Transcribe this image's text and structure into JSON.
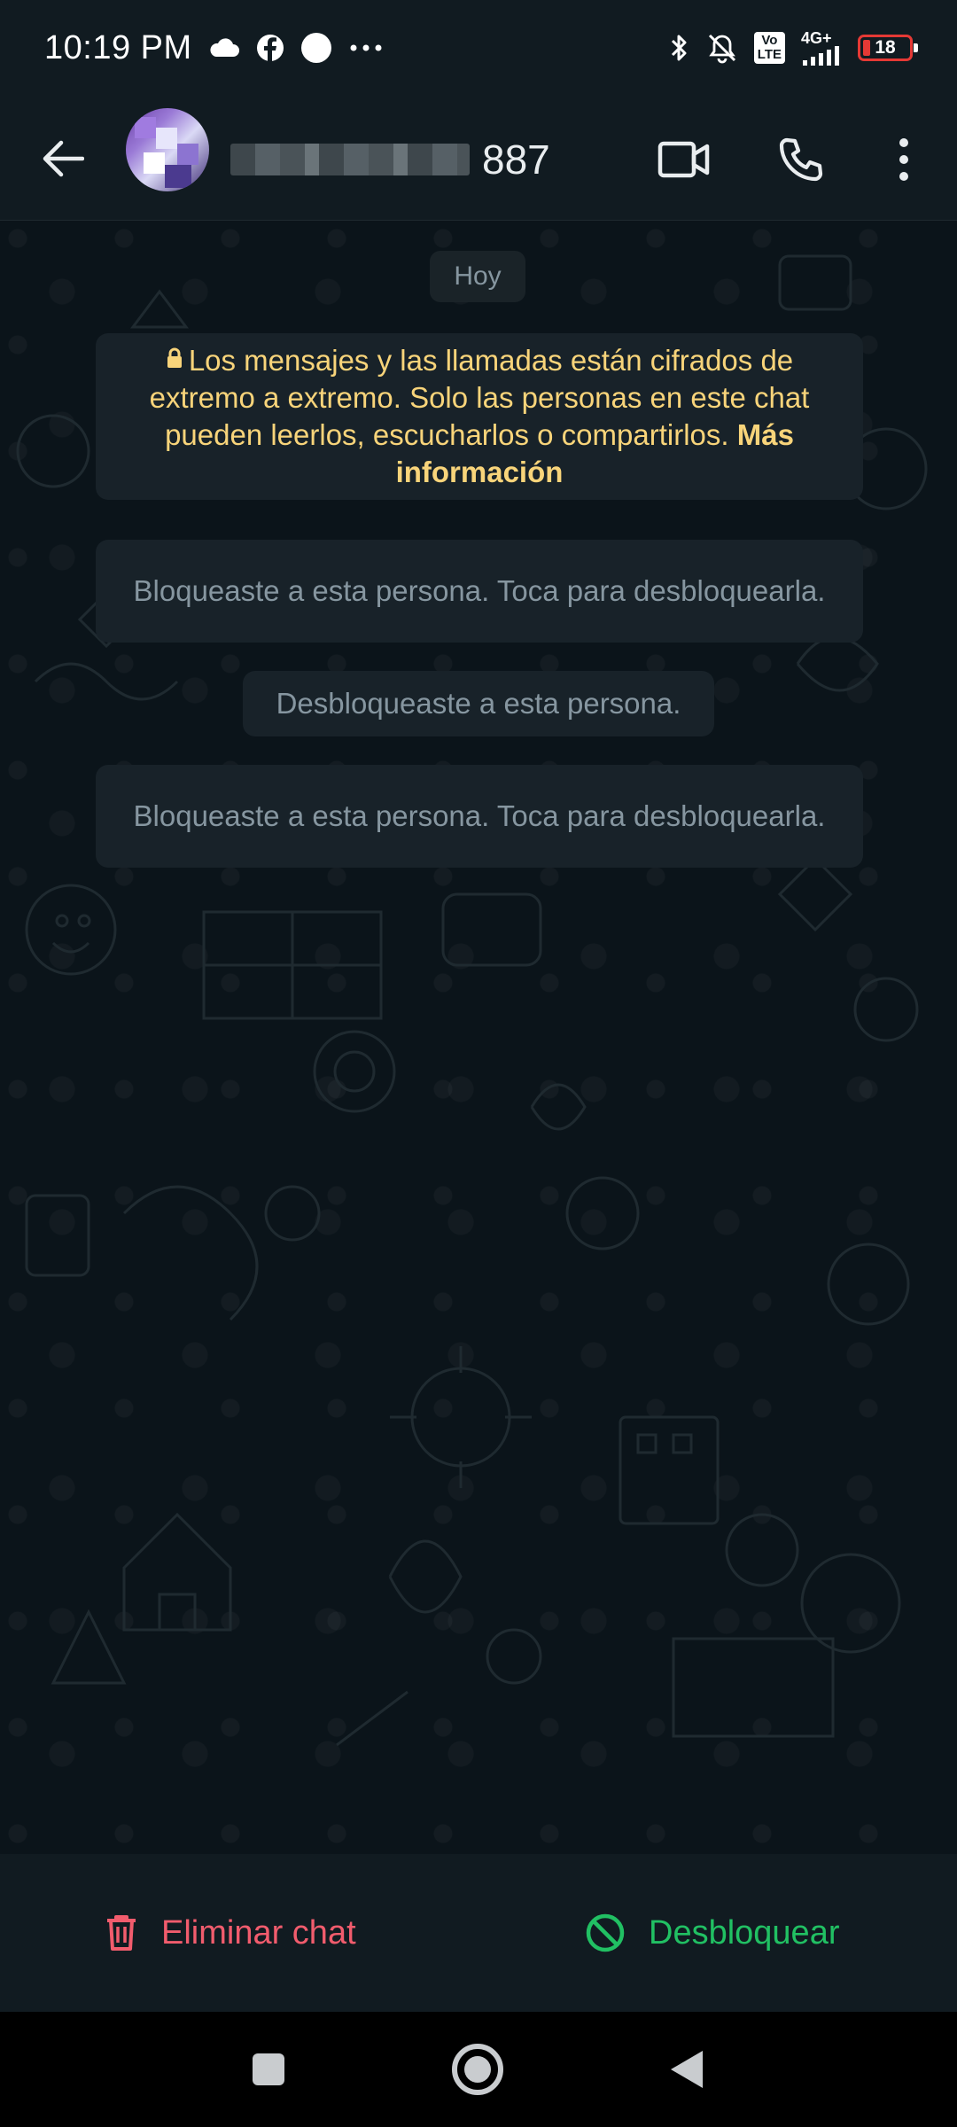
{
  "status_bar": {
    "time": "10:19 PM",
    "left_icons": [
      "cloud-icon",
      "facebook-icon",
      "circle-notification-icon",
      "more-dots-icon"
    ],
    "right_icons": [
      "bluetooth-icon",
      "bell-muted-icon",
      "volte-icon",
      "signal-icon",
      "battery-icon"
    ],
    "volte_label": "Vo\nLTE",
    "network_label": "4G+",
    "battery_level": "18",
    "battery_color": "#e53935"
  },
  "app_bar": {
    "contact_name_visible": "887",
    "actions": [
      "back-arrow-icon",
      "video-call-icon",
      "phone-icon",
      "more-vert-icon"
    ]
  },
  "chat": {
    "date_chip": "Hoy",
    "encryption_notice": {
      "text": "Los mensajes y las llamadas están cifrados de extremo a extremo. Solo las personas en este chat pueden leerlos, escucharlos o compartirlos.",
      "link": "Más información",
      "color": "#f8d47a"
    },
    "system_messages": [
      "Bloqueaste a esta persona. Toca para desbloquearla.",
      "Desbloqueaste a esta persona.",
      "Bloqueaste a esta persona. Toca para desbloquearla."
    ]
  },
  "action_bar": {
    "delete_label": "Eliminar chat",
    "delete_color": "#f15c6d",
    "unblock_label": "Desbloquear",
    "unblock_color": "#21c063"
  },
  "nav_bar": {
    "buttons": [
      "recents-square-icon",
      "home-circle-icon",
      "back-triangle-icon"
    ]
  }
}
